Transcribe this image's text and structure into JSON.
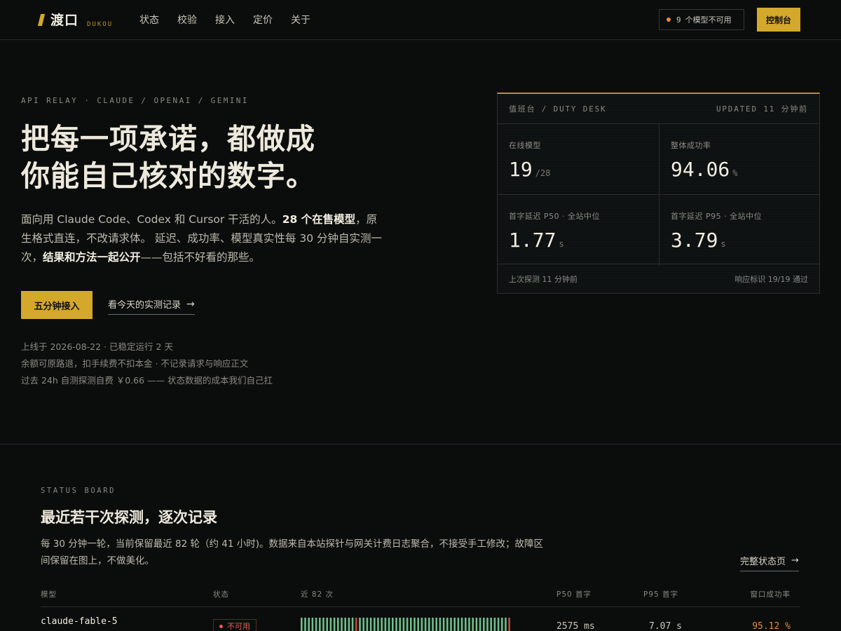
{
  "header": {
    "logo_text": "渡口",
    "logo_sub": "DUKOU",
    "nav": [
      "状态",
      "校验",
      "接入",
      "定价",
      "关于"
    ],
    "alert_count": "9",
    "alert_text": "个模型不可用",
    "console_label": "控制台",
    "colors": {
      "accent": "#d4a82a",
      "alert": "#e8873a"
    }
  },
  "hero": {
    "eyebrow": "API RELAY · CLAUDE / OPENAI / GEMINI",
    "title_line1": "把每一项承诺，都做成",
    "title_line2": "你能自己核对的数字。",
    "desc": {
      "p1": "面向用 Claude Code、Codex 和 Cursor 干活的人。",
      "p1_bold": "28 个在售模型",
      "p2": "，原生格式直连，不改请求体。 延迟、成功率、模型真实性每 30 分钟自实测一次，",
      "p2_bold": "结果和方法一起公开",
      "p3": "——包括不好看的那些。"
    },
    "cta_primary": "五分钟接入",
    "cta_link": "看今天的实测记录",
    "cta_arrow": "→",
    "meta": [
      "上线于 2026-08-22 · 已稳定运行 2 天",
      "余额可原路退，扣手续费不扣本金 · 不记录请求与响应正文",
      "过去 24h 自测探测自费 ￥0.66 —— 状态数据的成本我们自己扛"
    ]
  },
  "desk": {
    "title": "值班台 / DUTY DESK",
    "updated": "UPDATED 11 分钟前",
    "cells": [
      {
        "label": "在线模型",
        "value": "19",
        "unit": "/28"
      },
      {
        "label": "整体成功率",
        "value": "94.06",
        "unit": "%"
      },
      {
        "label": "首字延迟 P50 · 全站中位",
        "value": "1.77",
        "unit": "s"
      },
      {
        "label": "首字延迟 P95 · 全站中位",
        "value": "3.79",
        "unit": "s"
      }
    ],
    "footer_left": "上次探测 11 分钟前",
    "footer_right": "响应标识 19/19 通过"
  },
  "status_board": {
    "eyebrow": "STATUS BOARD",
    "title": "最近若干次探测，逐次记录",
    "desc": "每 30 分钟一轮，当前保留最近 82 轮（约 41 小时)。数据来自本站探针与网关计费日志聚合，不接受手工修改；故障区间保留在图上，不做美化。",
    "link": "完整状态页",
    "link_arrow": "→",
    "columns": [
      "模型",
      "状态",
      "近 82 次",
      "P50 首字",
      "P95 首字",
      "窗口成功率"
    ],
    "rows": [
      {
        "model": "claude-fable-5",
        "status": "不可用",
        "probes": "gggggggggggggggrgggggggggggggggggggggggggggggggggggggggggr",
        "p50": "2575 ms",
        "p95": "7.07 s",
        "rate": "95.12 %"
      }
    ],
    "probe_colors": {
      "g": "#6fbf8a",
      "r": "#c9463c"
    }
  }
}
